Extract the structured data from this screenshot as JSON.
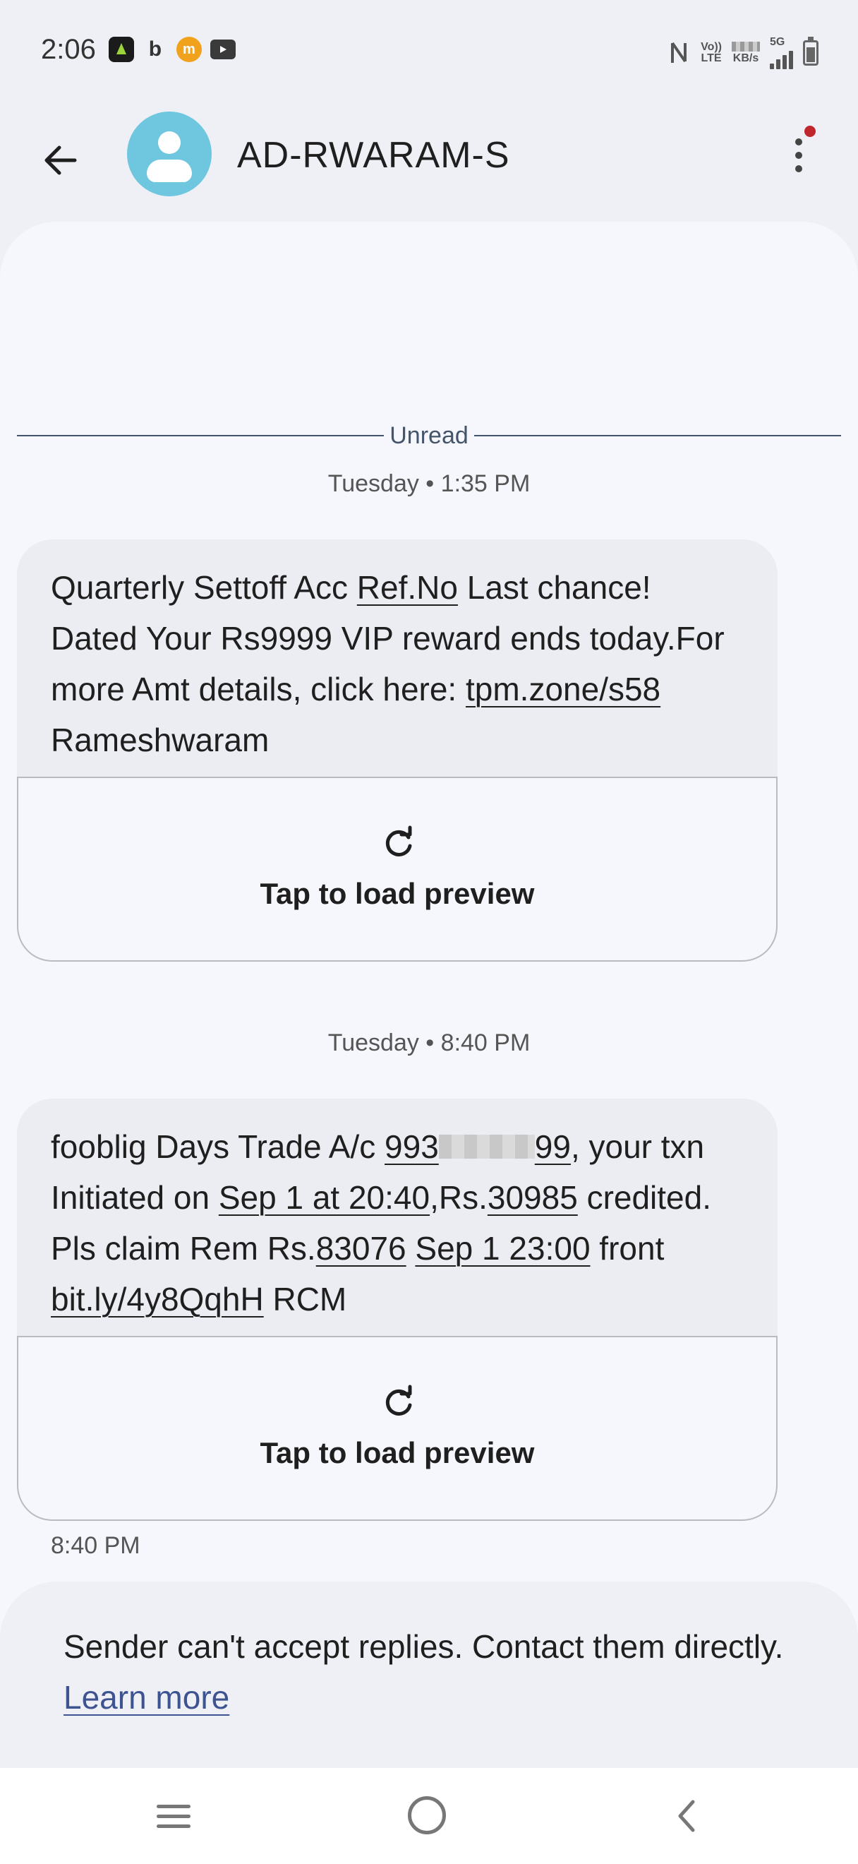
{
  "status_bar": {
    "time": "2:06",
    "net_label_top": "Vo)) ",
    "net_label_bottom": "LTE",
    "speed_unit": "KB/s",
    "network": "5G"
  },
  "header": {
    "title": "AD-RWARAM-S"
  },
  "unread_label": "Unread",
  "messages": [
    {
      "timestamp": "Tuesday • 1:35 PM",
      "parts": {
        "p1": "Quarterly Settoff Acc ",
        "link1": "Ref.No",
        "p2": "  Last chance! Dated Your Rs9999 VIP reward ends today.For more Amt details, click here: ",
        "link2": "tpm.zone/s58",
        "p3": "  Rameshwaram"
      },
      "preview_label": "Tap to load preview"
    },
    {
      "timestamp": "Tuesday • 8:40 PM",
      "parts": {
        "p1": "fooblig Days Trade A/c ",
        "link1a": "993",
        "link1b": "99",
        "p2": ", your txn Initiated on ",
        "link2": "Sep 1 at 20:40",
        "p3": ",Rs.",
        "link3": "30985",
        "p4": " credited. Pls claim Rem Rs.",
        "link4": "83076",
        "p5": " ",
        "link5": "Sep 1 23:00",
        "p6": " front ",
        "link6": "bit.ly/4y8QqhH",
        "p7": " RCM"
      },
      "preview_label": "Tap to load preview",
      "sent_time": "8:40 PM"
    }
  ],
  "reply_notice": {
    "text": "Sender can't accept replies. Contact them directly. ",
    "link": "Learn more"
  },
  "colors": {
    "accent_link": "#3d5490",
    "avatar_bg": "#6fc7df",
    "notification_dot": "#c0272d"
  },
  "icons": [
    "back-arrow-icon",
    "avatar-person-icon",
    "more-vert-icon",
    "reload-icon",
    "nav-menu-icon",
    "nav-home-icon",
    "nav-back-icon"
  ]
}
